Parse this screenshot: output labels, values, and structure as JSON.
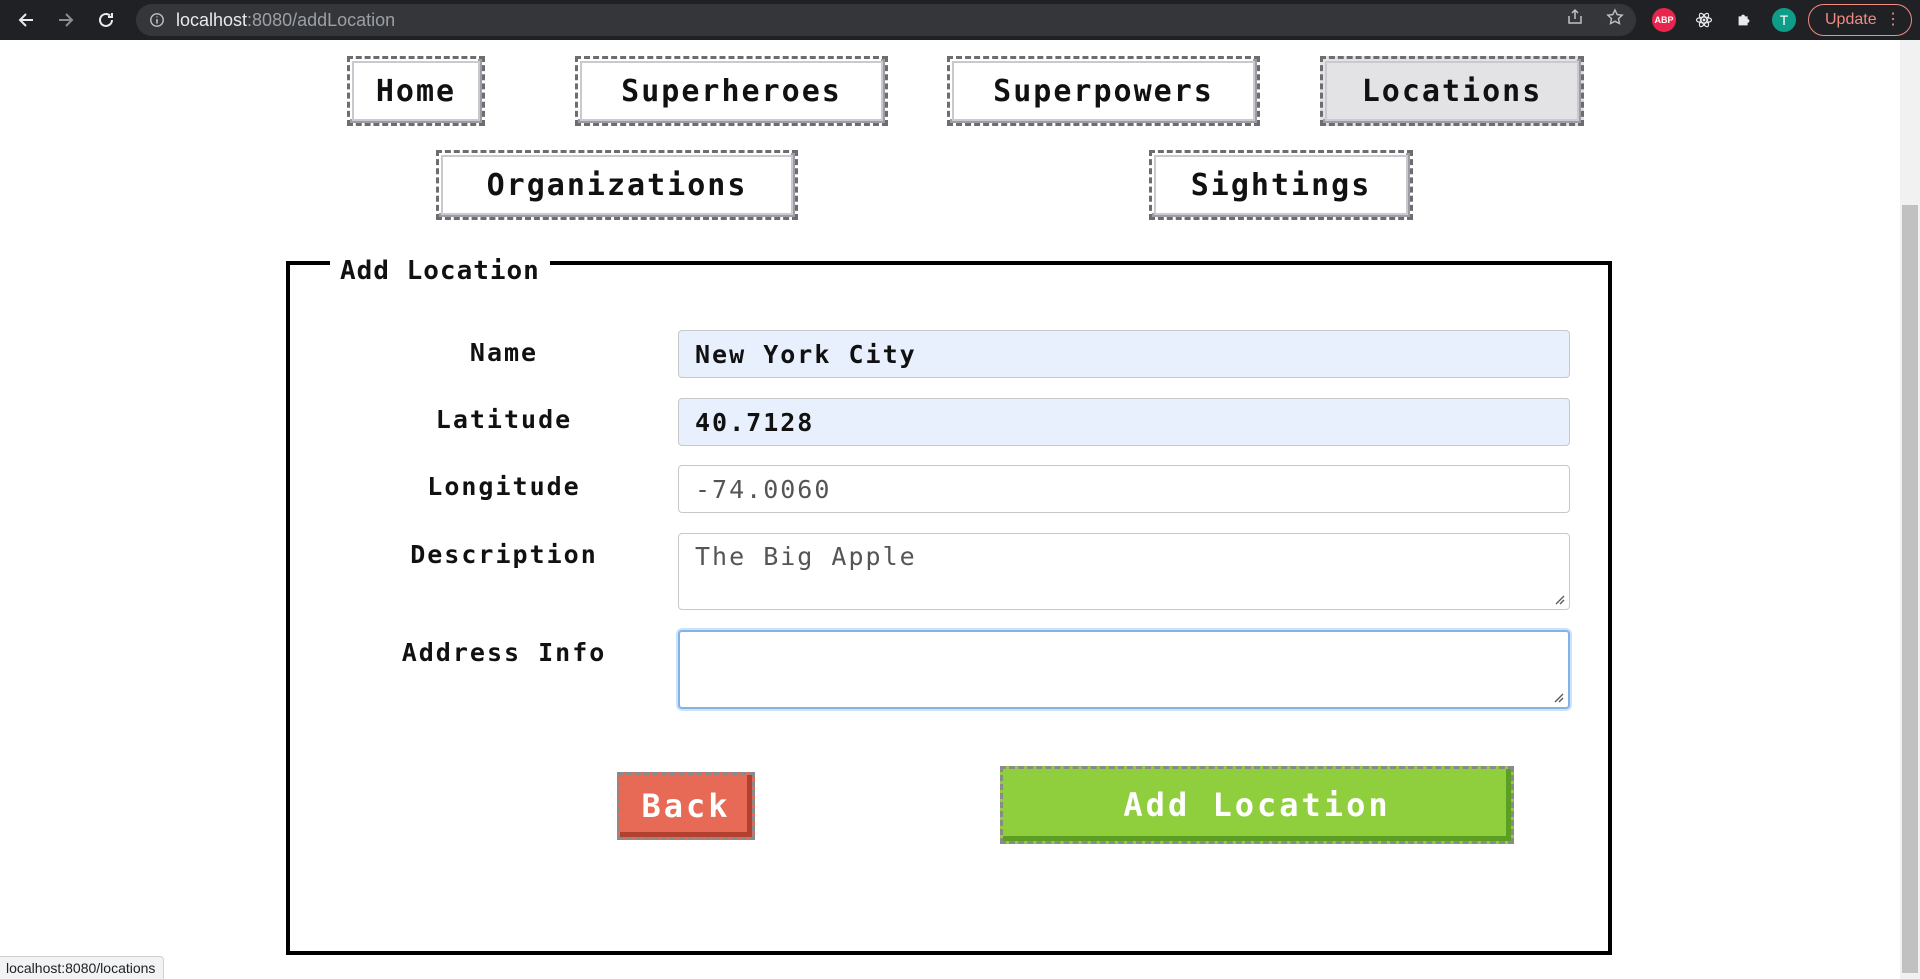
{
  "browser": {
    "url_host": "localhost",
    "url_rest": ":8080/addLocation",
    "update_label": "Update",
    "profile_initial": "T",
    "abp_label": "ABP",
    "status_url": "localhost:8080/locations"
  },
  "nav": {
    "home": "Home",
    "superheroes": "Superheroes",
    "superpowers": "Superpowers",
    "locations": "Locations",
    "organizations": "Organizations",
    "sightings": "Sightings"
  },
  "form": {
    "legend": "Add Location",
    "name_label": "Name",
    "name_value": "New York City",
    "latitude_label": "Latitude",
    "latitude_value": "40.7128",
    "longitude_label": "Longitude",
    "longitude_value": "-74.0060",
    "description_label": "Description",
    "description_value": "The Big Apple",
    "address_label": "Address Info",
    "address_value": "",
    "back_label": "Back",
    "submit_label": "Add Location"
  },
  "colors": {
    "back_button": "#e66a55",
    "submit_button": "#8fcf3e",
    "autofill": "#e8f0fe"
  }
}
